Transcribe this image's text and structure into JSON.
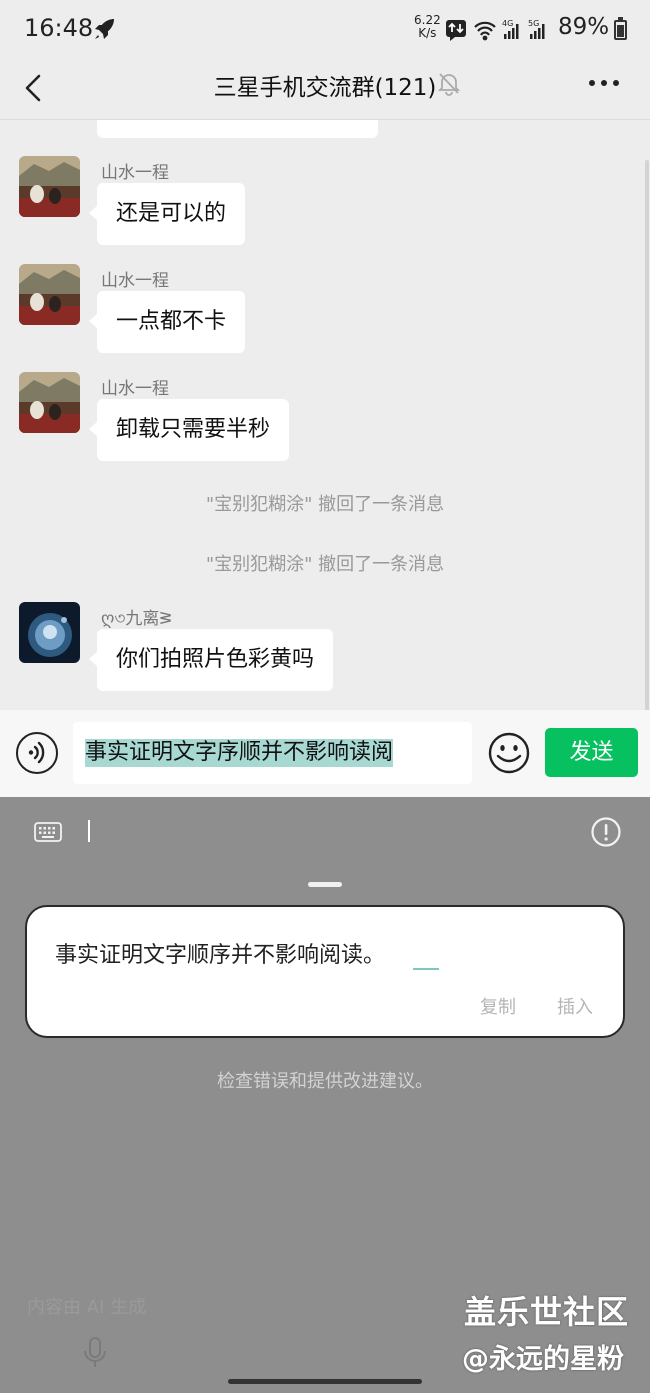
{
  "status_bar": {
    "time": "16:48",
    "net_speed_value": "6.22",
    "net_speed_unit": "K/s",
    "signal_4g": "4G",
    "signal_5g": "5G",
    "battery": "89%"
  },
  "header": {
    "title": "三星手机交流群(121)"
  },
  "messages": [
    {
      "sender": "山水一程",
      "text": "还是可以的"
    },
    {
      "sender": "山水一程",
      "text": "一点都不卡"
    },
    {
      "sender": "山水一程",
      "text": "卸载只需要半秒"
    },
    {
      "sender": "ღ৩九离ᕒ",
      "text": "你们拍照片色彩黄吗"
    }
  ],
  "system_messages": [
    "\"宝别犯糊涂\" 撤回了一条消息",
    "\"宝别犯糊涂\" 撤回了一条消息"
  ],
  "input": {
    "value": "事实证明文字序顺并不影响读阅",
    "send_label": "发送"
  },
  "ai_panel": {
    "suggestion": "事实证明文字顺序并不影响阅读。",
    "copy_label": "复制",
    "insert_label": "插入",
    "hint": "检查错误和提供改进建议。",
    "ai_note": "内容由 AI 生成"
  },
  "watermark": {
    "line1": "盖乐世社区",
    "line2": "@永远的星粉"
  },
  "colors": {
    "send_button": "#07c160",
    "selection_highlight": "#a8d8d2",
    "panel_background": "#8e8e8e"
  }
}
